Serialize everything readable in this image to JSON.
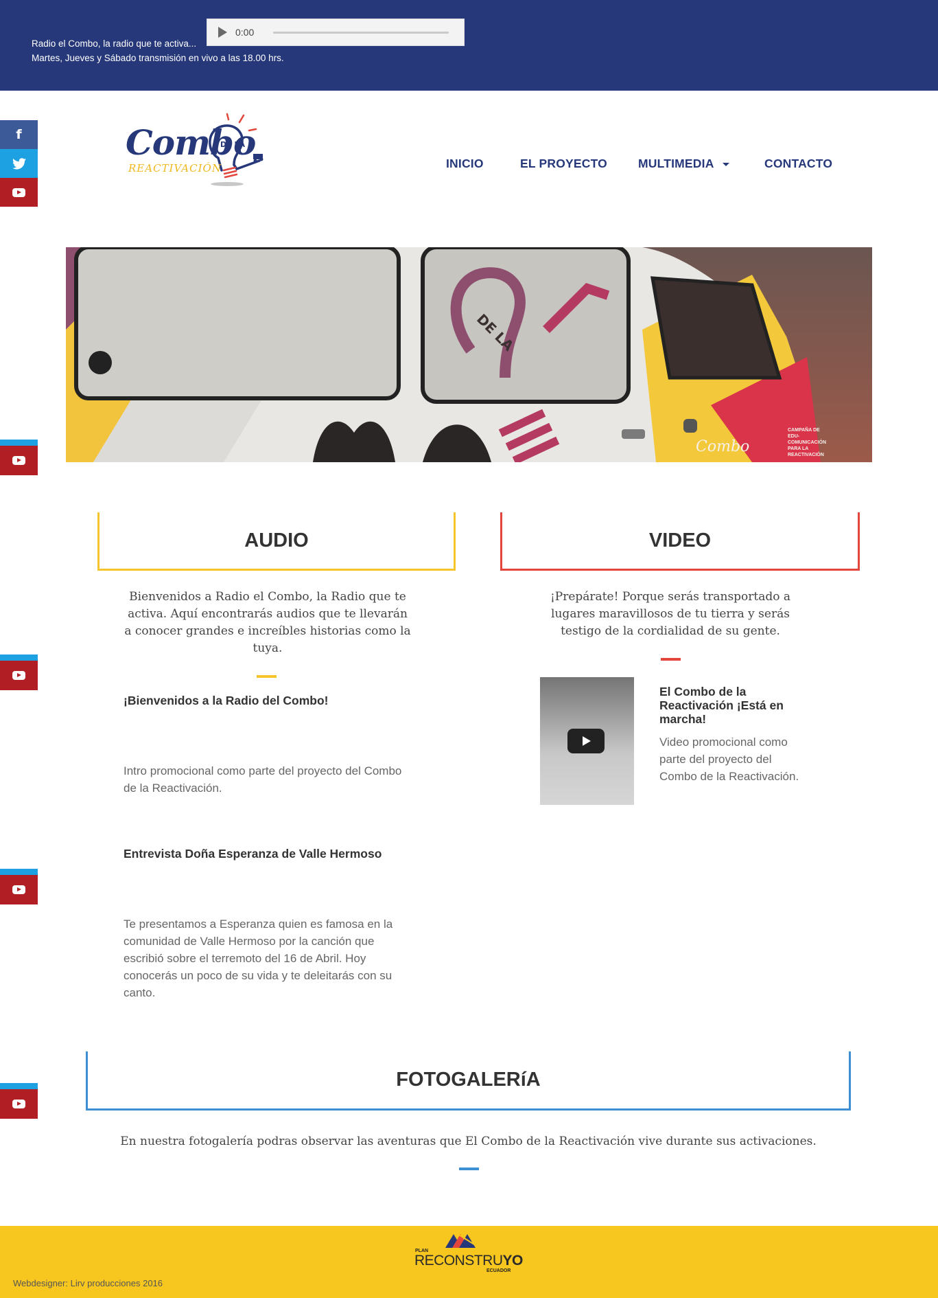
{
  "topbar": {
    "line1": "Radio el Combo, la radio que te activa...",
    "line2": "Martes, Jueves y Sábado transmisión en vivo a las 18.00 hrs.",
    "player_time": "0:00"
  },
  "logo": {
    "text_main": "Combo",
    "text_sub": "REACTIVACIÓN",
    "badge": "DE LA"
  },
  "nav": {
    "items": [
      "INICIO",
      "EL PROYECTO",
      "MULTIMEDIA",
      "CONTACTO"
    ]
  },
  "social": {
    "facebook": "f",
    "twitter": "t"
  },
  "hero": {
    "van_text": "CAMPAÑA DE EDU-COMUNICACIÓN PARA LA REACTIVACIÓN",
    "van_badge": "DE LA",
    "van_logo": "Combo"
  },
  "audio": {
    "heading": "AUDIO",
    "lead": "Bienvenidos a Radio el Combo, la Radio que te activa. Aquí encontrarás audios que te llevarán a conocer grandes e increíbles historias como la tuya.",
    "items": [
      {
        "title": "¡Bienvenidos a la Radio del Combo!",
        "desc": "Intro promocional como parte del proyecto del Combo de la Reactivación."
      },
      {
        "title": "Entrevista Doña Esperanza de Valle Hermoso",
        "desc": "Te presentamos a Esperanza quien es famosa en la comunidad de Valle Hermoso por la canción que escribió sobre el terremoto del 16 de Abril. Hoy conocerás un poco de su vida y te deleitarás con su canto."
      }
    ]
  },
  "video": {
    "heading": "VIDEO",
    "lead": "¡Prepárate! Porque serás transportado a lugares maravillosos de tu tierra y serás testigo de la cordialidad de su gente.",
    "item": {
      "title": "El Combo de la Reactivación ¡Está en marcha!",
      "desc": "Video promocional como parte del proyecto del Combo de la Reactivación."
    }
  },
  "gallery": {
    "heading": "FOTOGALERíA",
    "lead": "En nuestra fotogalería podras observar las aventuras que El Combo de la Reactivación vive durante sus activaciones."
  },
  "footer": {
    "credit": "Webdesigner: Lirv producciones 2016",
    "plan_small": "PLAN",
    "plan_big_a": "RECONSTRU",
    "plan_big_b": "YO",
    "plan_country": "ECUADOR"
  },
  "colors": {
    "brand_blue": "#26387a",
    "audio_accent": "#f5c52b",
    "video_accent": "#e2463c",
    "gallery_accent": "#3d8ed3",
    "footer_yellow": "#f8c71f",
    "youtube_red": "#b11f24",
    "twitter_blue": "#1da1e2",
    "facebook_blue": "#3d5a98"
  }
}
